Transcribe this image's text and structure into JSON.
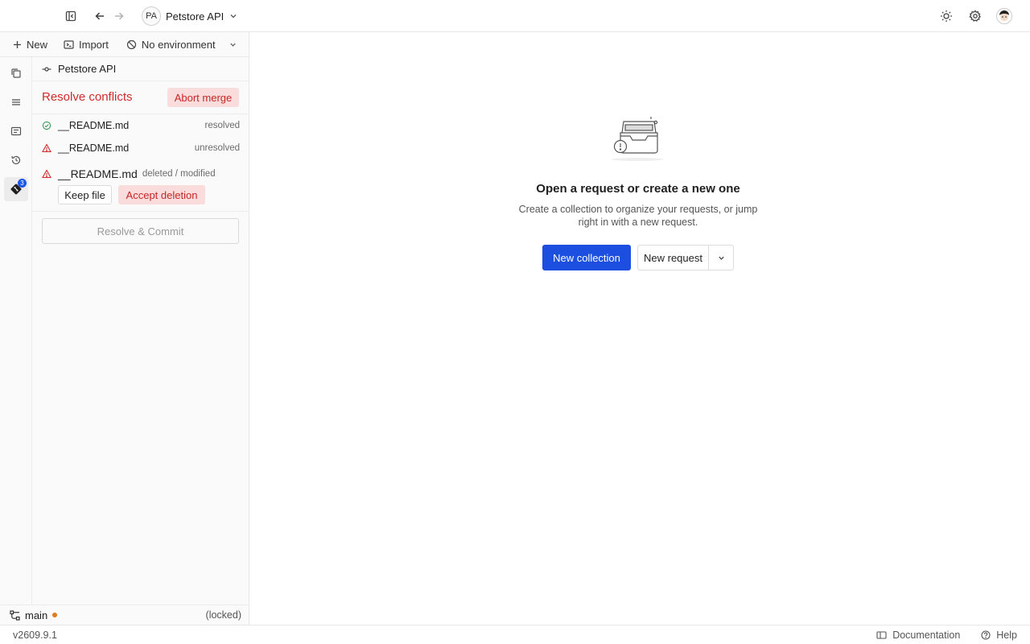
{
  "topbar": {
    "workspace_initials": "PA",
    "workspace_name": "Petstore API"
  },
  "toolbar": {
    "new_label": "New",
    "import_label": "Import",
    "environment_label": "No environment"
  },
  "rail": {
    "items": [
      {
        "icon": "copy-icon"
      },
      {
        "icon": "layers-icon"
      },
      {
        "icon": "list-card-icon"
      },
      {
        "icon": "history-icon"
      },
      {
        "icon": "git-icon",
        "badge": "3",
        "active": true
      }
    ]
  },
  "panel": {
    "collection_name": "Petstore API",
    "conflicts_title": "Resolve conflicts",
    "abort_label": "Abort merge",
    "files": [
      {
        "name": "__README.md",
        "status": "resolved",
        "icon": "check-circle-icon"
      },
      {
        "name": "__README.md",
        "status": "unresolved",
        "icon": "warning-icon"
      },
      {
        "name": "__README.md",
        "status": "deleted / modified",
        "icon": "warning-icon"
      }
    ],
    "keep_label": "Keep file",
    "accept_deletion_label": "Accept deletion",
    "commit_label": "Resolve & Commit"
  },
  "branch": {
    "name": "main",
    "locked_text": "(locked)"
  },
  "status": {
    "version": "v2609.9.1",
    "documentation": "Documentation",
    "help": "Help"
  },
  "empty": {
    "title": "Open a request or create a new one",
    "subtitle": "Create a collection to organize your requests, or jump right in with a new request.",
    "primary_label": "New collection",
    "secondary_label": "New request"
  },
  "colors": {
    "accent": "#1c4fe0",
    "danger": "#d12b2b",
    "danger_bg": "#fbdcdc",
    "warning_dot": "#e07a1e"
  }
}
